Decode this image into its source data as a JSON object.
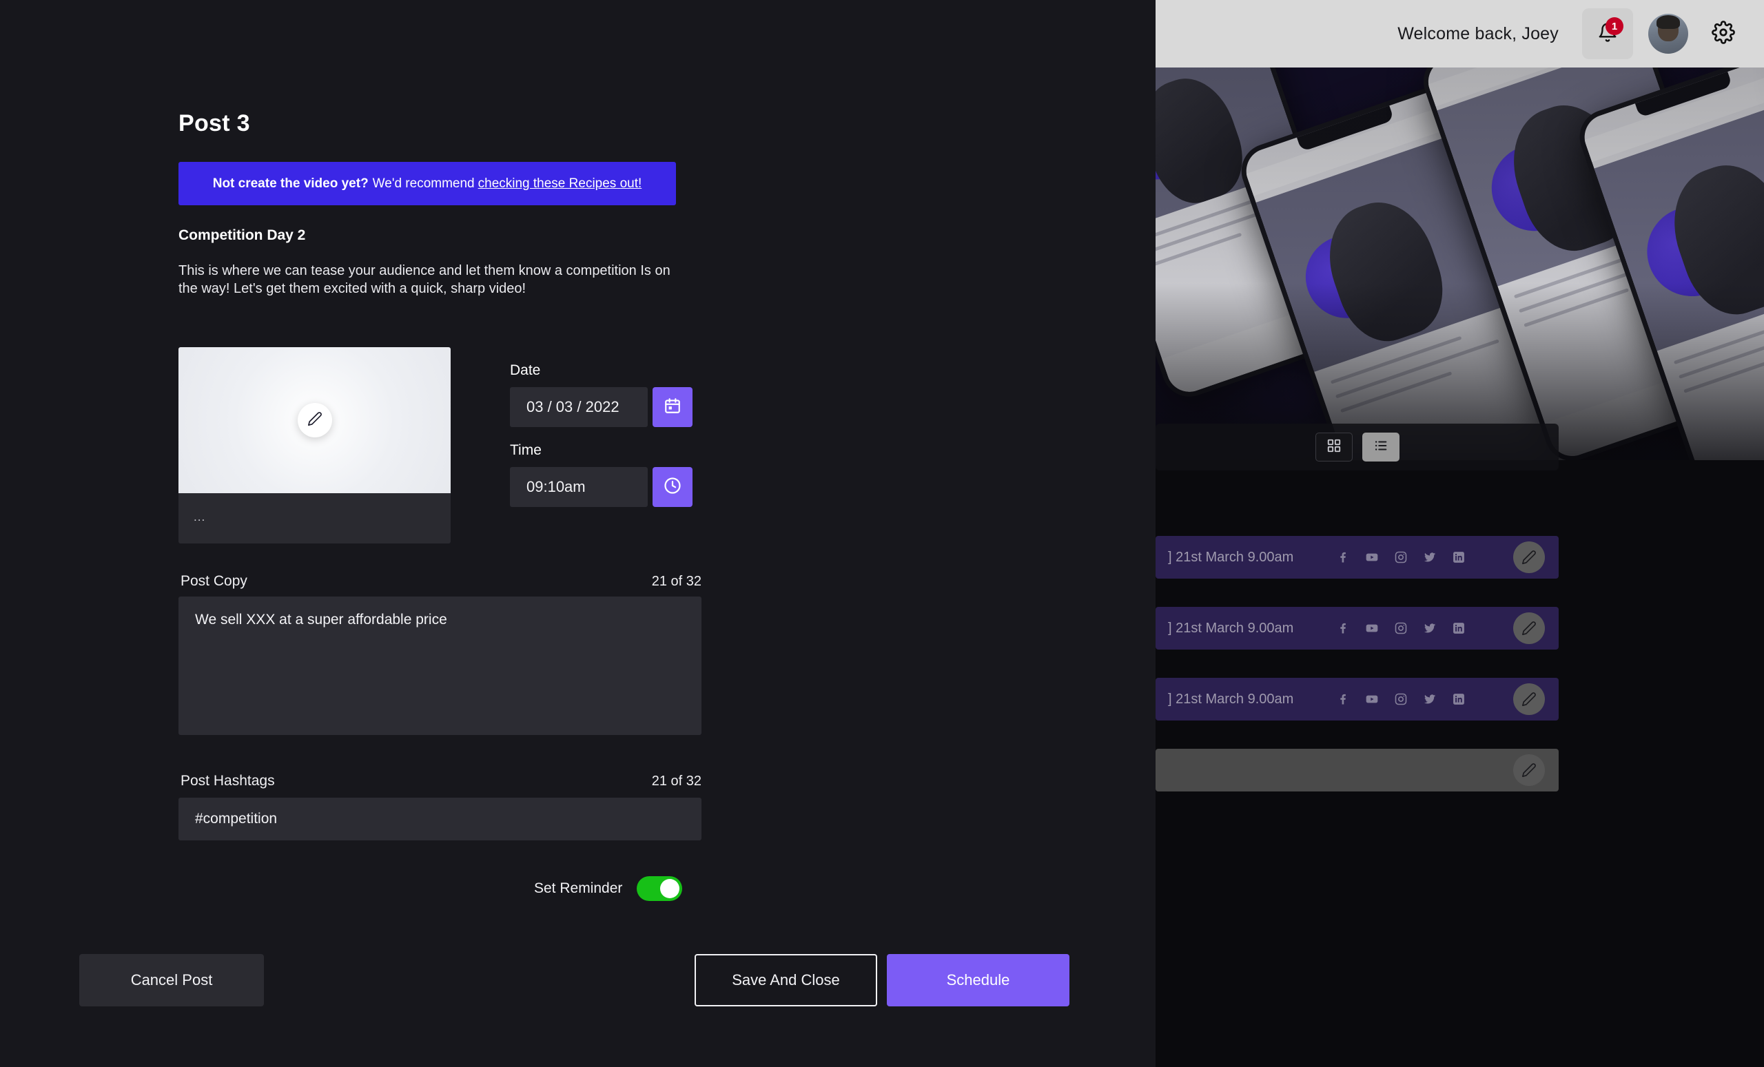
{
  "app": {
    "header": {
      "welcome": "Welcome back, Joey",
      "notification_count": "1",
      "bell_icon": "bell-icon",
      "gear_icon": "gear-icon",
      "avatar_icon": "avatar"
    },
    "view_toggle": {
      "grid_label": "grid-view",
      "list_label": "list-view",
      "active": "list"
    },
    "post_rows": [
      {
        "when": "] 21st March 9.00am",
        "socials": [
          "facebook",
          "youtube",
          "instagram",
          "twitter",
          "linkedin"
        ],
        "edit": "edit-icon"
      },
      {
        "when": "] 21st March 9.00am",
        "socials": [
          "facebook",
          "youtube",
          "instagram",
          "twitter",
          "linkedin"
        ],
        "edit": "edit-icon"
      },
      {
        "when": "] 21st March 9.00am",
        "socials": [
          "facebook",
          "youtube",
          "instagram",
          "twitter",
          "linkedin"
        ],
        "edit": "edit-icon"
      },
      {
        "when": "",
        "socials": [],
        "edit": "edit-icon"
      }
    ]
  },
  "modal": {
    "title": "Post 3",
    "banner": {
      "bold": "Not create the video yet?",
      "middle": "We'd recommend",
      "link": "checking these Recipes out!",
      "color": "#3b27e6"
    },
    "subtitle": "Competition Day 2",
    "description": "This is where we can tease your audience and let them know a competition Is on the way! Let's get them excited with a quick, sharp video!",
    "thumbnail": {
      "edit_icon": "pencil-icon",
      "caption": "..."
    },
    "date": {
      "label": "Date",
      "value": "03 / 03 / 2022",
      "icon": "calendar-icon"
    },
    "time": {
      "label": "Time",
      "value": "09:10am",
      "icon": "clock-icon"
    },
    "post_copy": {
      "label": "Post Copy",
      "count": "21 of 32",
      "value": "We sell XXX at a super affordable price"
    },
    "post_hashtags": {
      "label": "Post Hashtags",
      "count": "21 of 32",
      "value": "#competition"
    },
    "reminder": {
      "label": "Set Reminder",
      "state": "on",
      "on_color": "#17c017"
    },
    "buttons": {
      "cancel": "Cancel Post",
      "save": "Save And Close",
      "schedule": "Schedule",
      "schedule_color": "#7c5cf5"
    }
  }
}
